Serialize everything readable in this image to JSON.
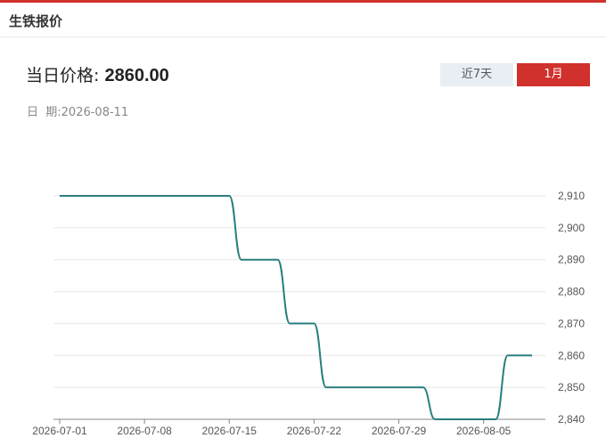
{
  "header": {
    "title": "生铁报价"
  },
  "price": {
    "label": "当日价格:",
    "value": "2860.00"
  },
  "date": {
    "label": "日  期:",
    "value": "2026-08-11"
  },
  "tabs": [
    {
      "label": "近7天"
    },
    {
      "label": "1月"
    }
  ],
  "colors": {
    "accent": "#d0312d",
    "line": "#2a7f7f",
    "tab_inactive": "#e9eef5"
  },
  "chart_data": {
    "type": "line",
    "x": [
      "2026-07-01",
      "2026-07-15",
      "2026-07-16",
      "2026-07-19",
      "2026-07-20",
      "2026-07-22",
      "2026-07-23",
      "2026-07-31",
      "2026-08-01",
      "2026-08-06",
      "2026-08-07",
      "2026-08-09"
    ],
    "series": [
      {
        "values": [
          2910,
          2910,
          2890,
          2890,
          2870,
          2870,
          2850,
          2850,
          2840,
          2840,
          2860,
          2860
        ]
      }
    ],
    "x_ticks": [
      "2026-07-01",
      "2026-07-08",
      "2026-07-15",
      "2026-07-22",
      "2026-07-29",
      "2026-08-05"
    ],
    "y_ticks": [
      2840,
      2850,
      2860,
      2870,
      2880,
      2890,
      2900,
      2910
    ],
    "y_tick_labels": [
      "2,840",
      "2,850",
      "2,860",
      "2,870",
      "2,880",
      "2,890",
      "2,900",
      "2,910"
    ],
    "ylim": [
      2840,
      2910
    ],
    "grid": true,
    "y_axis_side": "right"
  }
}
